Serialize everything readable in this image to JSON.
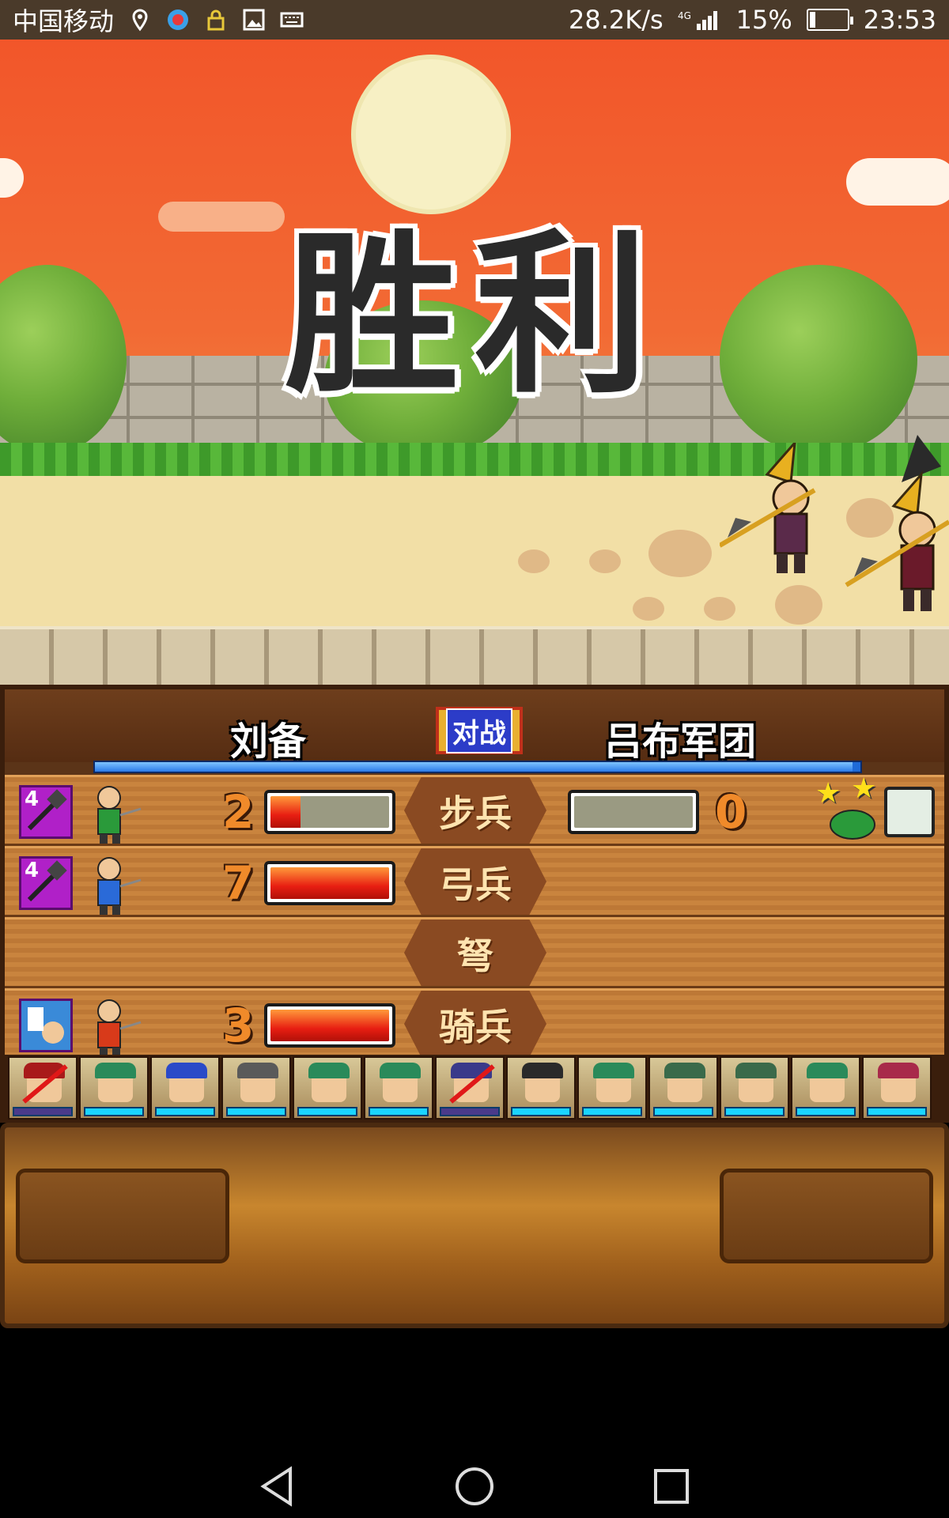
{
  "status_bar": {
    "carrier": "中国移动",
    "speed": "28.2K/s",
    "battery": "15%",
    "battery_level": 0.15,
    "time": "23:53",
    "icons": [
      "location-icon",
      "app-icon",
      "lock-icon",
      "image-icon",
      "keyboard-icon",
      "signal-icon",
      "battery-icon"
    ]
  },
  "scene": {
    "victory_text": "胜利"
  },
  "battle": {
    "player_name": "刘备",
    "vs_label": "对战",
    "enemy_name": "吕布军团",
    "power_ratio": 0.99,
    "rows": [
      {
        "type": "步兵",
        "player_count": "2",
        "player_fill": 0.25,
        "enemy_count": "0",
        "enemy_fill": 0,
        "has_enemy": true,
        "level": "4",
        "player_unit": true
      },
      {
        "type": "弓兵",
        "player_count": "7",
        "player_fill": 1.0,
        "has_enemy": false,
        "level": "4",
        "player_unit": true
      },
      {
        "type": "弩",
        "has_enemy": false,
        "player_unit": false
      },
      {
        "type": "骑兵",
        "player_count": "3",
        "player_fill": 1.0,
        "has_enemy": false,
        "player_unit": true
      }
    ],
    "portraits": [
      {
        "hair": "#a81a1a",
        "defeated": true
      },
      {
        "hair": "#2a8a5a",
        "defeated": false
      },
      {
        "hair": "#2a4ac8",
        "defeated": false
      },
      {
        "hair": "#5a5a5a",
        "defeated": false
      },
      {
        "hair": "#2a8a5a",
        "defeated": false
      },
      {
        "hair": "#2a8a5a",
        "defeated": false
      },
      {
        "hair": "#3a3a8a",
        "defeated": true
      },
      {
        "hair": "#2a2a2a",
        "defeated": false
      },
      {
        "hair": "#2a8a5a",
        "defeated": false
      },
      {
        "hair": "#3a6a4a",
        "defeated": false
      },
      {
        "hair": "#3a6a4a",
        "defeated": false
      },
      {
        "hair": "#2a8a5a",
        "defeated": false
      },
      {
        "hair": "#a82a4a",
        "defeated": false
      }
    ]
  },
  "colors": {
    "sky": "#f2562a",
    "hp_bar": "#e81e12",
    "power_bar": "#1e6ad8"
  }
}
